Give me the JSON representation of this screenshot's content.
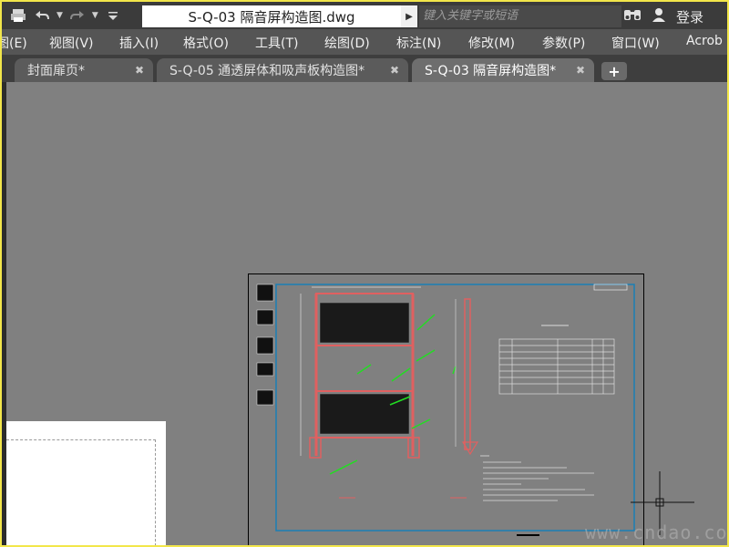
{
  "titlebar": {
    "file_title": "S-Q-03 隔音屏构造图.dwg",
    "search_placeholder": "键入关键字或短语",
    "login_label": "登录"
  },
  "menu": {
    "items": [
      "图(E)",
      "视图(V)",
      "插入(I)",
      "格式(O)",
      "工具(T)",
      "绘图(D)",
      "标注(N)",
      "修改(M)",
      "参数(P)",
      "窗口(W)",
      "Acrob"
    ]
  },
  "tabs": [
    {
      "label": "封面扉页*",
      "active": false
    },
    {
      "label": "S-Q-05 通透屏体和吸声板构造图*",
      "active": false
    },
    {
      "label": "S-Q-03 隔音屏构造图*",
      "active": true
    }
  ],
  "watermark": "www.cndao.com",
  "colors": {
    "accent_border": "#f2e64a",
    "canvas": "#808080",
    "drawing_frame": "#1a7fb5",
    "drawing_red": "#e06060",
    "drawing_green": "#22dd22"
  }
}
